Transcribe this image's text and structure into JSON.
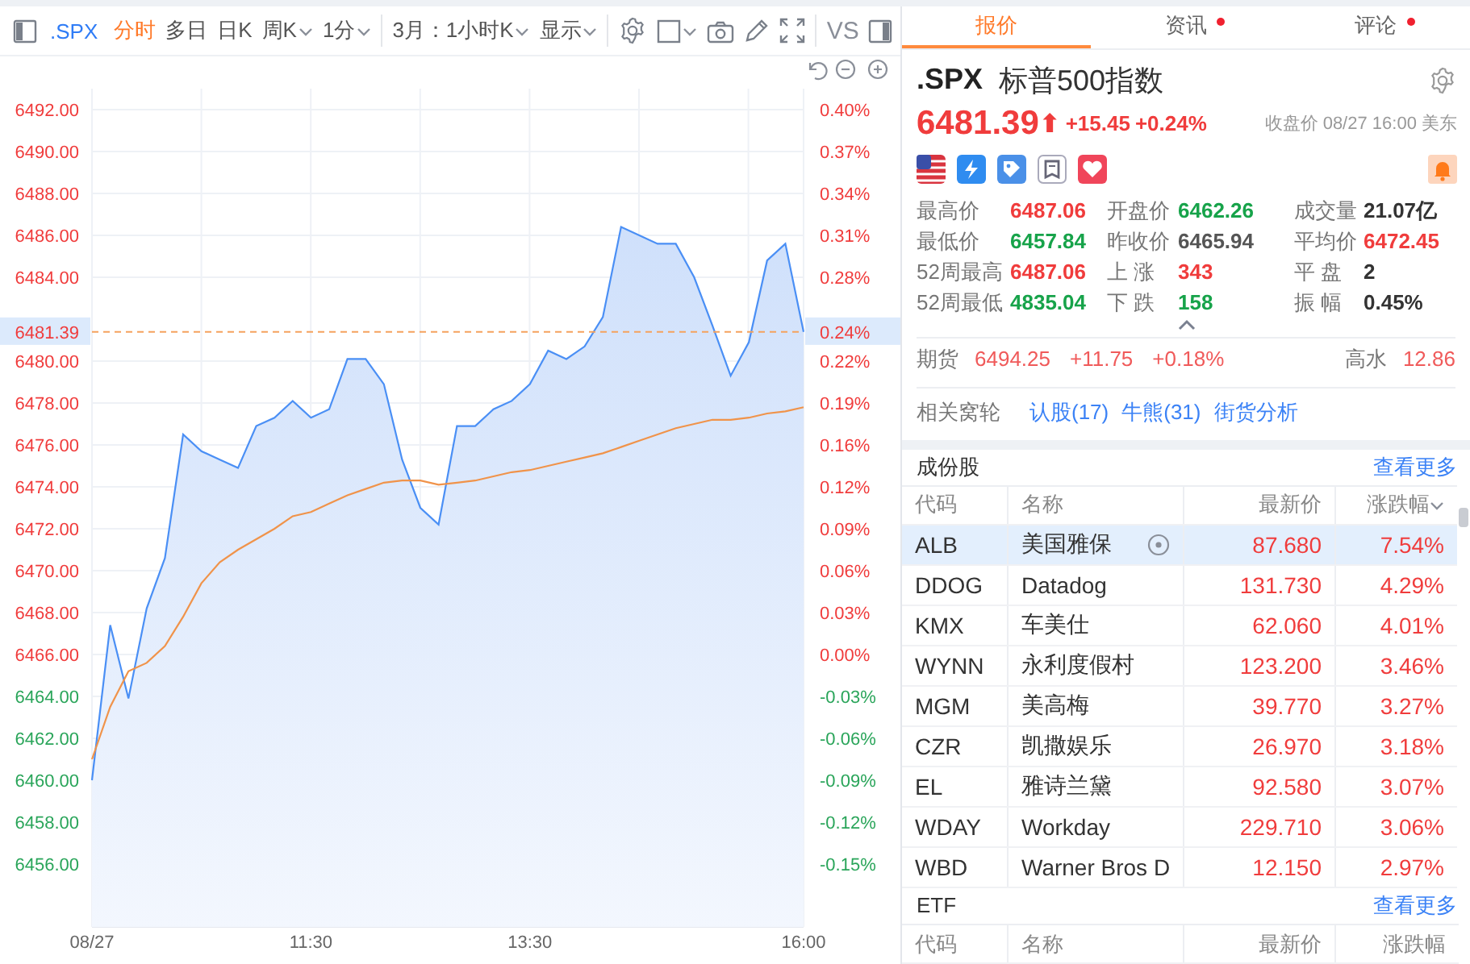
{
  "toolbar": {
    "symbol": ".SPX",
    "periods": [
      {
        "label": "分时",
        "selected": true,
        "dropdown": false
      },
      {
        "label": "多日",
        "selected": false,
        "dropdown": false
      },
      {
        "label": "日K",
        "selected": false,
        "dropdown": false
      },
      {
        "label": "周K",
        "selected": false,
        "dropdown": true
      },
      {
        "label": "1分",
        "selected": false,
        "dropdown": true
      }
    ],
    "range": "3月：1小时K",
    "display": "显示",
    "compare": "VS"
  },
  "chart": {
    "percent_labels": [
      {
        "text": "0.40%",
        "color": "#f03c3c"
      },
      {
        "text": "0.37%",
        "color": "#f03c3c"
      },
      {
        "text": "0.34%",
        "color": "#f03c3c"
      },
      {
        "text": "0.31%",
        "color": "#f03c3c"
      },
      {
        "text": "0.28%",
        "color": "#f03c3c"
      },
      {
        "text": "0.22%",
        "color": "#f03c3c"
      },
      {
        "text": "0.19%",
        "color": "#f03c3c"
      },
      {
        "text": "0.16%",
        "color": "#f03c3c"
      },
      {
        "text": "0.12%",
        "color": "#f03c3c"
      },
      {
        "text": "0.09%",
        "color": "#f03c3c"
      },
      {
        "text": "0.06%",
        "color": "#f03c3c"
      },
      {
        "text": "0.03%",
        "color": "#f03c3c"
      },
      {
        "text": "0.00%",
        "color": "#f03c3c"
      },
      {
        "text": "-0.03%",
        "color": "#2aa55a"
      },
      {
        "text": "-0.06%",
        "color": "#2aa55a"
      },
      {
        "text": "-0.09%",
        "color": "#2aa55a"
      },
      {
        "text": "-0.12%",
        "color": "#2aa55a"
      },
      {
        "text": "-0.15%",
        "color": "#2aa55a"
      }
    ],
    "last_percent": "0.24%",
    "chart_data": {
      "type": "area",
      "grid": true,
      "categories": [
        "08/27",
        null,
        null,
        null,
        null,
        null,
        null,
        null,
        null,
        null,
        null,
        null,
        "11:30",
        null,
        null,
        null,
        null,
        null,
        null,
        null,
        null,
        null,
        null,
        null,
        "13:30",
        null,
        null,
        null,
        null,
        null,
        null,
        null,
        null,
        null,
        null,
        null,
        null,
        null,
        null,
        "16:00"
      ],
      "series": [
        {
          "color": "#4a8ff5",
          "values": [
            6460,
            6467.4,
            6463.9,
            6468.2,
            6470.6,
            6476.5,
            6475.7,
            6475.3,
            6474.9,
            6476.9,
            6477.3,
            6478.1,
            6477.3,
            6477.7,
            6480.1,
            6480.1,
            6478.9,
            6475.3,
            6473,
            6472.2,
            6476.9,
            6476.9,
            6477.7,
            6478.1,
            6478.9,
            6480.5,
            6480.1,
            6480.7,
            6482.1,
            6486.4,
            6486,
            6485.6,
            6485.6,
            6484,
            6481.7,
            6479.3,
            6480.9,
            6484.8,
            6485.6,
            6481.39
          ]
        },
        {
          "type": "line",
          "color": "#f0934a",
          "values": [
            6461,
            6463.5,
            6465.2,
            6465.6,
            6466.4,
            6467.8,
            6469.4,
            6470.4,
            6471,
            6471.5,
            6472,
            6472.6,
            6472.8,
            6473.2,
            6473.6,
            6473.9,
            6474.2,
            6474.3,
            6474.3,
            6474.1,
            6474.2,
            6474.3,
            6474.5,
            6474.7,
            6474.8,
            6475,
            6475.2,
            6475.4,
            6475.6,
            6475.9,
            6476.2,
            6476.5,
            6476.8,
            6477,
            6477.2,
            6477.2,
            6477.3,
            6477.5,
            6477.6,
            6477.8
          ]
        }
      ],
      "ylim": [
        6453,
        6493
      ],
      "yticks": [
        {
          "value": 6492,
          "label": "6492.00"
        },
        {
          "value": 6490,
          "label": "6490.00"
        },
        {
          "value": 6488,
          "label": "6488.00"
        },
        {
          "value": 6486,
          "label": "6486.00"
        },
        {
          "value": 6484,
          "label": "6484.00"
        },
        {
          "value": 6480,
          "label": "6480.00"
        },
        {
          "value": 6478,
          "label": "6478.00"
        },
        {
          "value": 6476,
          "label": "6476.00"
        },
        {
          "value": 6474,
          "label": "6474.00"
        },
        {
          "value": 6472,
          "label": "6472.00"
        },
        {
          "value": 6470,
          "label": "6470.00"
        },
        {
          "value": 6468,
          "label": "6468.00"
        },
        {
          "value": 6466,
          "label": "6466.00"
        },
        {
          "value": 6464,
          "label": "6464.00"
        },
        {
          "value": 6462,
          "label": "6462.00"
        },
        {
          "value": 6460,
          "label": "6460.00"
        },
        {
          "value": 6458,
          "label": "6458.00"
        },
        {
          "value": 6456,
          "label": "6456.00"
        }
      ],
      "ref_lines": [
        {
          "axis": "y",
          "value": 6481.39,
          "label": "6481.39"
        }
      ]
    }
  },
  "panel": {
    "tabs": [
      {
        "label": "报价",
        "selected": true,
        "badge": false
      },
      {
        "label": "资讯",
        "selected": false,
        "badge": true
      },
      {
        "label": "评论",
        "selected": false,
        "badge": true
      }
    ],
    "symbol": ".SPX",
    "name": "标普500指数",
    "price": "6481.39",
    "arrow": "⬆",
    "color": "#f03c3c",
    "change": "+15.45",
    "change_pct": "+0.24%",
    "close_info": "收盘价 08/27 16:00 美东",
    "stats": [
      {
        "label": "最高价",
        "value": "6487.06",
        "color": "#f03c3c"
      },
      {
        "label": "开盘价",
        "value": "6462.26",
        "color": "#17a34a"
      },
      {
        "label": "成交量",
        "value": "21.07亿",
        "color": "#333333"
      },
      {
        "label": "最低价",
        "value": "6457.84",
        "color": "#17a34a"
      },
      {
        "label": "昨收价",
        "value": "6465.94",
        "color": "#555555"
      },
      {
        "label": "平均价",
        "value": "6472.45",
        "color": "#f03c3c"
      },
      {
        "label": "52周最高",
        "value": "6487.06",
        "color": "#f03c3c"
      },
      {
        "label": "上 涨",
        "value": "343",
        "color": "#f03c3c"
      },
      {
        "label": "平 盘",
        "value": "2",
        "color": "#333333"
      },
      {
        "label": "52周最低",
        "value": "4835.04",
        "color": "#17a34a"
      },
      {
        "label": "下 跌",
        "value": "158",
        "color": "#17a34a"
      },
      {
        "label": "振 幅",
        "value": "0.45%",
        "color": "#333333"
      }
    ],
    "futures": {
      "label": "期货",
      "price": "6494.25",
      "change": "+11.75",
      "change_pct": "+0.18%",
      "color": "#f05a5a",
      "premium_label": "高水",
      "premium": "12.86"
    },
    "warrants": {
      "label": "相关窝轮",
      "links": [
        "认股(17)",
        "牛熊(31)",
        "街货分析"
      ]
    },
    "constituents": {
      "title": "成份股",
      "more": "查看更多",
      "columns": [
        {
          "label": "代码",
          "sorted": false
        },
        {
          "label": "名称",
          "sorted": false
        },
        {
          "label": "最新价",
          "sorted": false
        },
        {
          "label": "涨跌幅",
          "sorted": true
        }
      ],
      "rows": [
        {
          "code": "ALB",
          "name": "美国雅保",
          "price": "87.680",
          "change_pct": "7.54%",
          "color": "#f03c3c",
          "selected": true
        },
        {
          "code": "DDOG",
          "name": "Datadog",
          "price": "131.730",
          "change_pct": "4.29%",
          "color": "#f03c3c",
          "selected": false
        },
        {
          "code": "KMX",
          "name": "车美仕",
          "price": "62.060",
          "change_pct": "4.01%",
          "color": "#f03c3c",
          "selected": false
        },
        {
          "code": "WYNN",
          "name": "永利度假村",
          "price": "123.200",
          "change_pct": "3.46%",
          "color": "#f03c3c",
          "selected": false
        },
        {
          "code": "MGM",
          "name": "美高梅",
          "price": "39.770",
          "change_pct": "3.27%",
          "color": "#f03c3c",
          "selected": false
        },
        {
          "code": "CZR",
          "name": "凯撒娱乐",
          "price": "26.970",
          "change_pct": "3.18%",
          "color": "#f03c3c",
          "selected": false
        },
        {
          "code": "EL",
          "name": "雅诗兰黛",
          "price": "92.580",
          "change_pct": "3.07%",
          "color": "#f03c3c",
          "selected": false
        },
        {
          "code": "WDAY",
          "name": "Workday",
          "price": "229.710",
          "change_pct": "3.06%",
          "color": "#f03c3c",
          "selected": false
        },
        {
          "code": "WBD",
          "name": "Warner Bros D",
          "price": "12.150",
          "change_pct": "2.97%",
          "color": "#f03c3c",
          "selected": false
        }
      ]
    },
    "etf": {
      "title": "ETF",
      "more": "查看更多",
      "columns": [
        {
          "label": "代码",
          "sorted": false
        },
        {
          "label": "名称",
          "sorted": false
        },
        {
          "label": "最新价",
          "sorted": false
        },
        {
          "label": "涨跌幅",
          "sorted": false
        }
      ]
    }
  }
}
